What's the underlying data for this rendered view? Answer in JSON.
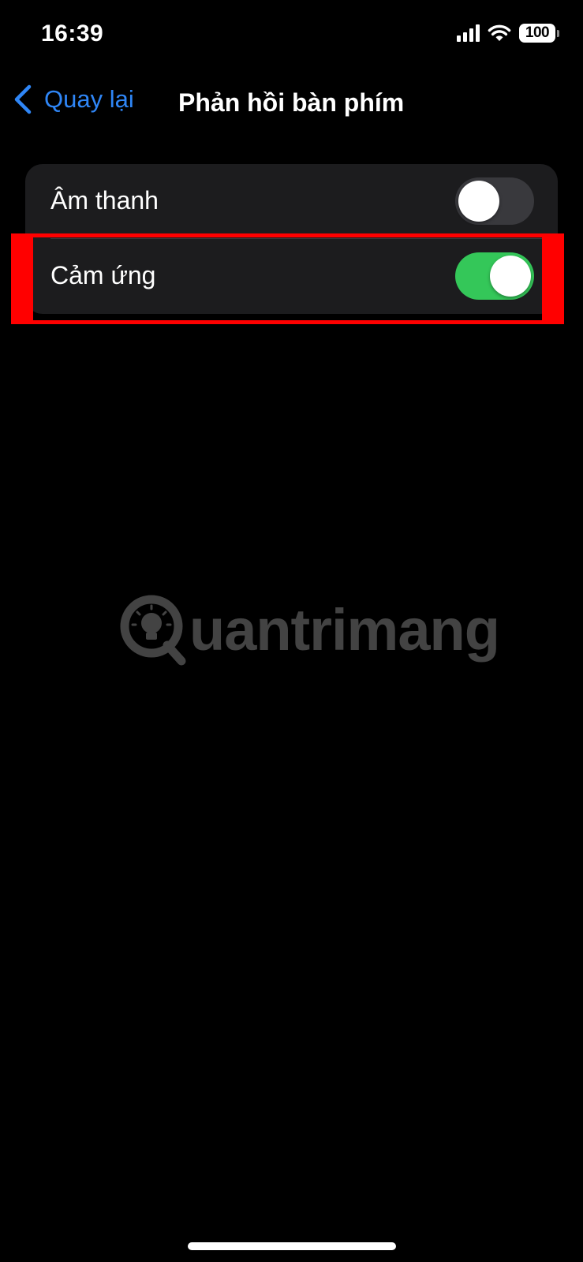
{
  "status_bar": {
    "time": "16:39",
    "battery_level": "100",
    "icons": [
      "cellular-signal-icon",
      "wifi-icon",
      "battery-icon"
    ]
  },
  "nav": {
    "back_label": "Quay lại",
    "title": "Phản hồi bàn phím",
    "back_icon": "chevron-left-icon"
  },
  "settings": {
    "rows": [
      {
        "label": "Âm thanh",
        "enabled": false
      },
      {
        "label": "Cảm ứng",
        "enabled": true
      }
    ]
  },
  "watermark": {
    "text": "uantrimang"
  },
  "colors": {
    "accent_blue": "#2f86f6",
    "toggle_on": "#34c759",
    "toggle_off": "#39393d",
    "group_background": "#1c1c1e",
    "highlight": "#ff0000"
  }
}
